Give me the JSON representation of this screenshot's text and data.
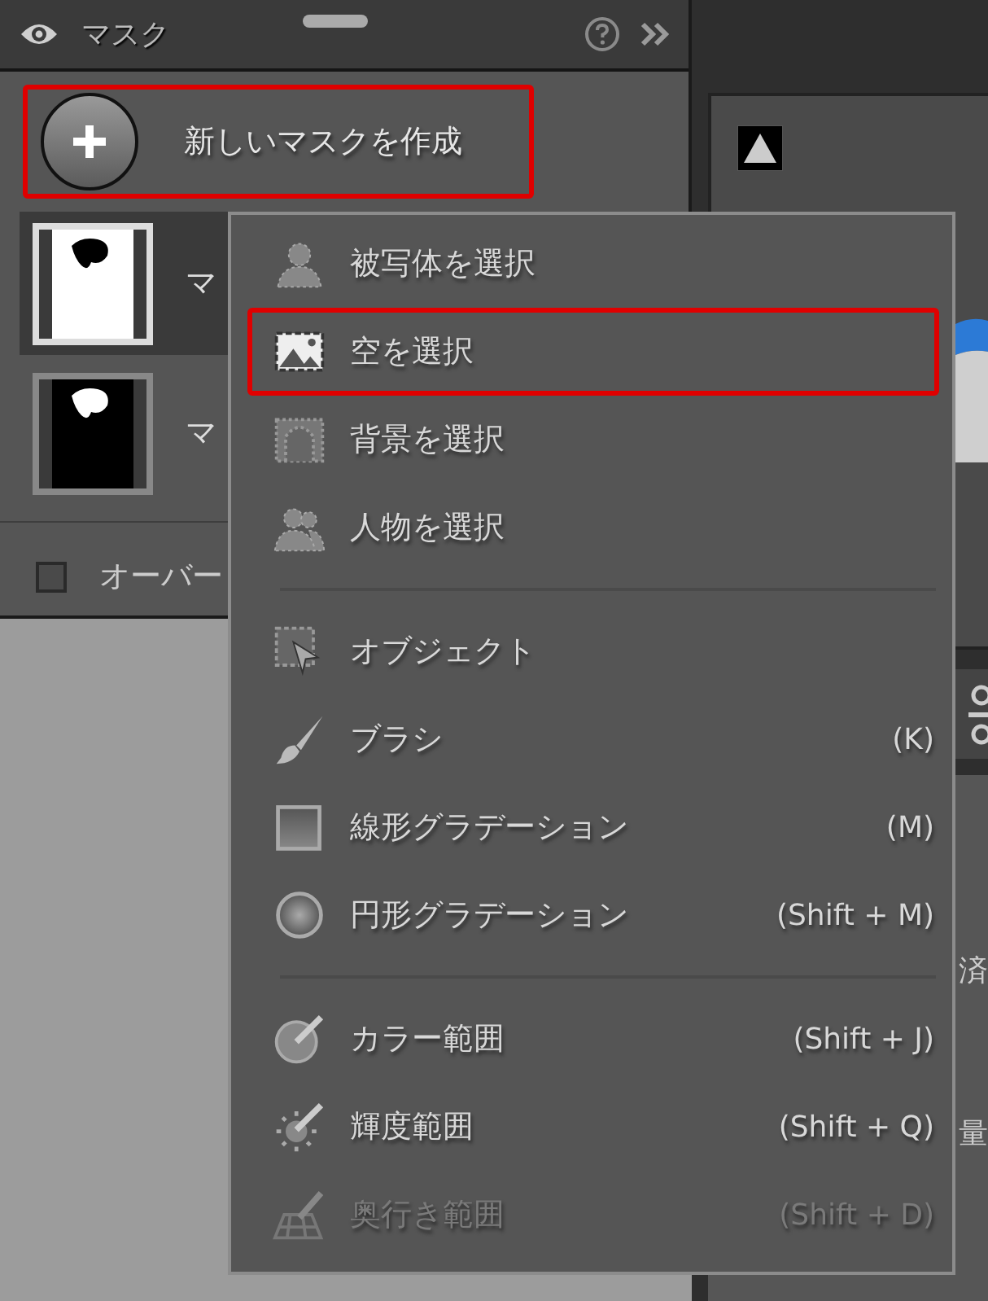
{
  "panel": {
    "title": "マスク",
    "create_button": {
      "label": "新しいマスクを作成",
      "highlighted": true
    },
    "masks": [
      {
        "label": "マ",
        "selected": true
      },
      {
        "label": "マ",
        "selected": false
      }
    ],
    "overlay": {
      "label": "オーバー",
      "checked": false
    }
  },
  "side_panel": {
    "texts": [
      "済",
      "量"
    ]
  },
  "menu": {
    "sections": [
      [
        {
          "label": "被写体を選択",
          "highlighted": false,
          "disabled": false
        },
        {
          "label": "空を選択",
          "highlighted": true,
          "disabled": false
        },
        {
          "label": "背景を選択",
          "highlighted": false,
          "disabled": false
        },
        {
          "label": "人物を選択",
          "highlighted": false,
          "disabled": false
        }
      ],
      [
        {
          "label": "オブジェクト",
          "highlighted": false,
          "disabled": false
        },
        {
          "label": "ブラシ",
          "shortcut": "(K)",
          "highlighted": false,
          "disabled": false
        },
        {
          "label": "線形グラデーション",
          "shortcut": "(M)",
          "highlighted": false,
          "disabled": false
        },
        {
          "label": "円形グラデーション",
          "shortcut": "(Shift + M)",
          "highlighted": false,
          "disabled": false
        }
      ],
      [
        {
          "label": "カラー範囲",
          "shortcut": "(Shift + J)",
          "highlighted": false,
          "disabled": false
        },
        {
          "label": "輝度範囲",
          "shortcut": "(Shift + Q)",
          "highlighted": false,
          "disabled": false
        },
        {
          "label": "奥行き範囲",
          "shortcut": "(Shift + D)",
          "highlighted": false,
          "disabled": true
        }
      ]
    ]
  }
}
